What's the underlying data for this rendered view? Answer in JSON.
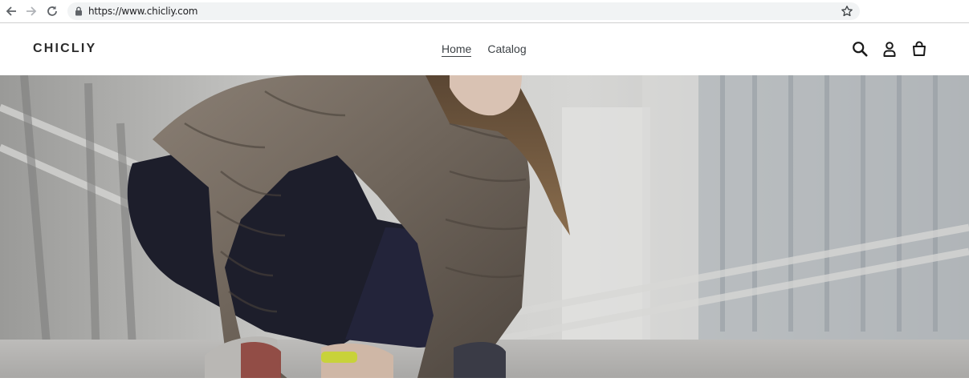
{
  "browser": {
    "url": "https://www.chicliy.com",
    "icons": [
      "back-arrow-icon",
      "forward-arrow-icon",
      "reload-icon",
      "lock-icon",
      "bookmark-star-icon"
    ]
  },
  "header": {
    "logo": "CHICLIY",
    "nav": [
      {
        "label": "Home",
        "active": true
      },
      {
        "label": "Catalog",
        "active": false
      }
    ],
    "icons": [
      "search-icon",
      "account-icon",
      "cart-icon"
    ]
  },
  "hero": {
    "image": "hero-image"
  },
  "colors": {
    "text": "#2b2b2b",
    "nav_text": "#3d4246",
    "omnibox_bg": "#f1f3f4"
  }
}
